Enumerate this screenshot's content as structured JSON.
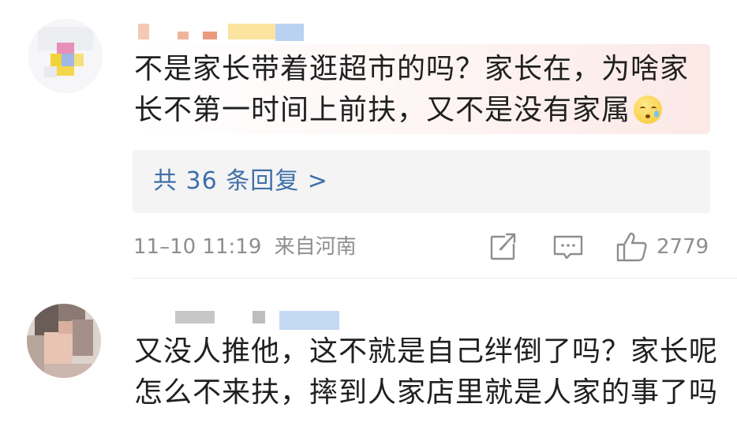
{
  "comments": [
    {
      "text_line1": "不是家长带着逛超市的吗？家长在，为啥家",
      "text_line2": "长不第一时间上前扶，又不是没有家属",
      "emoji": "sweat-face-emoji",
      "replies_label": "共 36 条回复 >",
      "time": "11–10 11:19",
      "location": "来自河南",
      "like_count": "2779"
    },
    {
      "text_line1": "又没人推他，这不就是自己绊倒了吗？家长呢",
      "text_line2": "怎么不来扶，摔到人家店里就是人家的事了吗"
    }
  ],
  "icons": {
    "share": "share-icon",
    "comment": "comment-icon",
    "like": "thumbs-up-icon"
  },
  "colors": {
    "text": "#202020",
    "link": "#3f6fa8",
    "meta": "#8e8e8e",
    "reply_bg": "#f4f4f4"
  }
}
